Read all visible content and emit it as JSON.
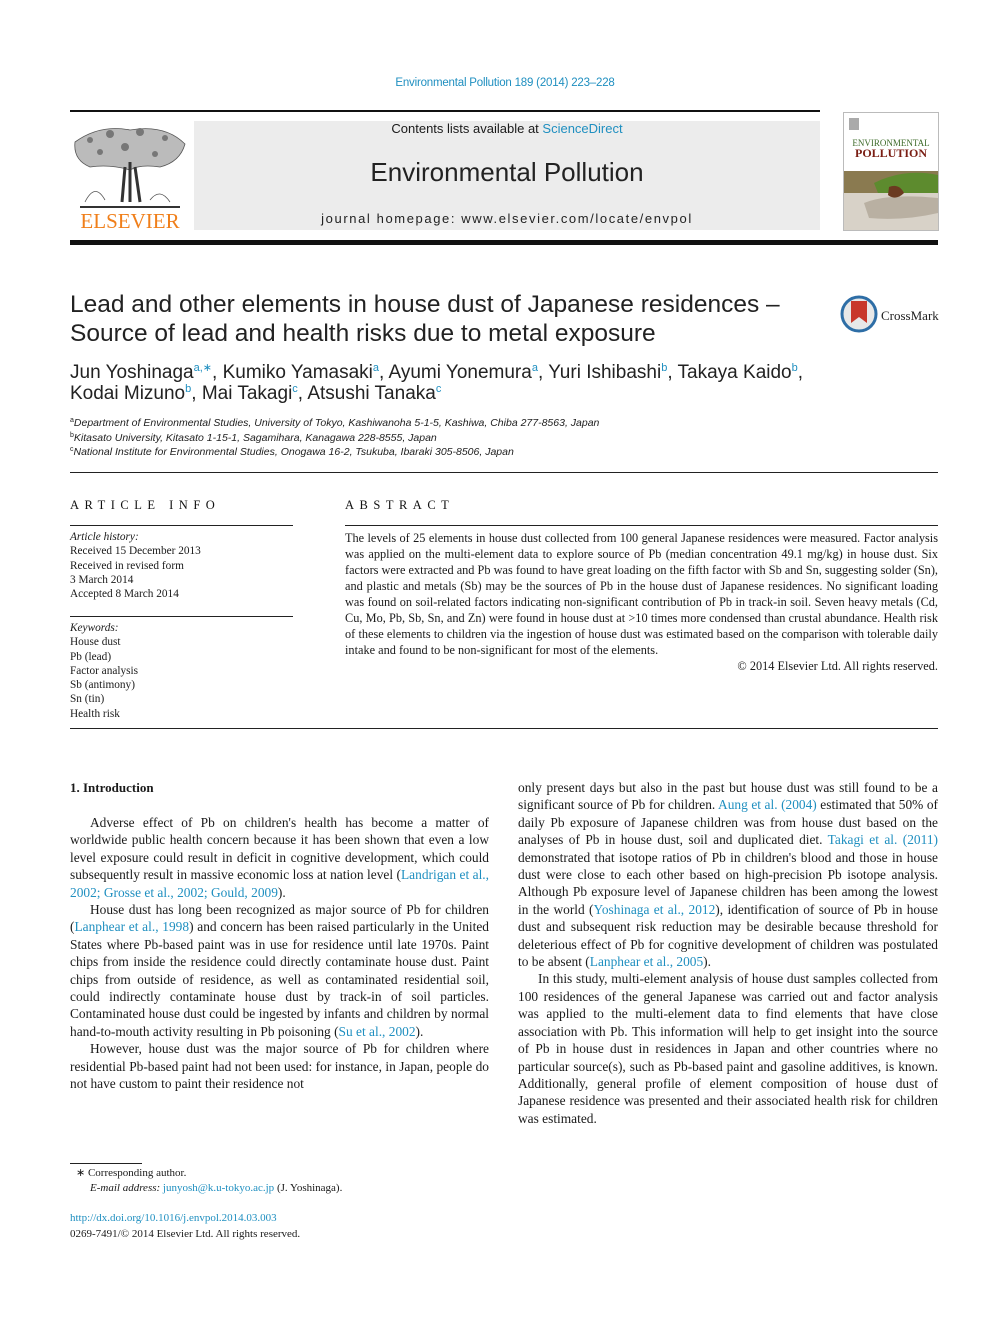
{
  "header": {
    "citation": "Environmental Pollution 189 (2014) 223–228",
    "contents_prefix": "Contents lists available at ",
    "contents_link": "ScienceDirect",
    "journal_name": "Environmental Pollution",
    "homepage": "journal homepage: www.elsevier.com/locate/envpol",
    "publisher_logo_text": "ELSEVIER",
    "cover_title_1": "ENVIRONMENTAL",
    "cover_title_2": "POLLUTION"
  },
  "article": {
    "title_line1": "Lead and other elements in house dust of Japanese residences –",
    "title_line2": "Source of lead and health risks due to metal exposure",
    "crossmark_label": "CrossMark",
    "authors": [
      {
        "name": "Jun Yoshinaga",
        "sup": "a,∗",
        "sep": ", "
      },
      {
        "name": "Kumiko Yamasaki",
        "sup": "a",
        "sep": ", "
      },
      {
        "name": "Ayumi Yonemura",
        "sup": "a",
        "sep": ", "
      },
      {
        "name": "Yuri Ishibashi",
        "sup": "b",
        "sep": ", "
      },
      {
        "name": "Takaya Kaido",
        "sup": "b",
        "sep": ","
      },
      {
        "name": "Kodai Mizuno",
        "sup": "b",
        "sep": ", "
      },
      {
        "name": "Mai Takagi",
        "sup": "c",
        "sep": ", "
      },
      {
        "name": "Atsushi Tanaka",
        "sup": "c",
        "sep": ""
      }
    ],
    "affiliations": [
      {
        "sup": "a",
        "text": "Department of Environmental Studies, University of Tokyo, Kashiwanoha 5-1-5, Kashiwa, Chiba 277-8563, Japan"
      },
      {
        "sup": "b",
        "text": "Kitasato University, Kitasato 1-15-1, Sagamihara, Kanagawa 228-8555, Japan"
      },
      {
        "sup": "c",
        "text": "National Institute for Environmental Studies, Onogawa 16-2, Tsukuba, Ibaraki 305-8506, Japan"
      }
    ]
  },
  "article_info": {
    "heading": "ARTICLE INFO",
    "history_label": "Article history:",
    "history": [
      "Received 15 December 2013",
      "Received in revised form",
      "3 March 2014",
      "Accepted 8 March 2014"
    ],
    "keywords_label": "Keywords:",
    "keywords": [
      "House dust",
      "Pb (lead)",
      "Factor analysis",
      "Sb (antimony)",
      "Sn (tin)",
      "Health risk"
    ]
  },
  "abstract": {
    "heading": "ABSTRACT",
    "text": "The levels of 25 elements in house dust collected from 100 general Japanese residences were measured. Factor analysis was applied on the multi-element data to explore source of Pb (median concentration 49.1 mg/kg) in house dust. Six factors were extracted and Pb was found to have great loading on the fifth factor with Sb and Sn, suggesting solder (Sn), and plastic and metals (Sb) may be the sources of Pb in the house dust of Japanese residences. No significant loading was found on soil-related factors indicating non-significant contribution of Pb in track-in soil. Seven heavy metals (Cd, Cu, Mo, Pb, Sb, Sn, and Zn) were found in house dust at >10 times more condensed than crustal abundance. Health risk of these elements to children via the ingestion of house dust was estimated based on the comparison with tolerable daily intake and found to be non-significant for most of the elements.",
    "copyright": "© 2014 Elsevier Ltd. All rights reserved."
  },
  "intro": {
    "heading": "1.  Introduction",
    "p1_a": "Adverse effect of Pb on children's health has become a matter of worldwide public health concern because it has been shown that even a low level exposure could result in deficit in cognitive development, which could subsequently result in massive economic loss at nation level (",
    "p1_ref": "Landrigan et al., 2002; Grosse et al., 2002; Gould, 2009",
    "p1_b": ").",
    "p2_a": "House dust has long been recognized as major source of Pb for children (",
    "p2_ref1": "Lanphear et al., 1998",
    "p2_b": ") and concern has been raised particularly in the United States where Pb-based paint was in use for residence until late 1970s. Paint chips from inside the residence could directly contaminate house dust. Paint chips from outside of residence, as well as contaminated residential soil, could indirectly contaminate house dust by track-in of soil particles. Contaminated house dust could be ingested by infants and children by normal hand-to-mouth activity resulting in Pb poisoning (",
    "p2_ref2": "Su et al., 2002",
    "p2_c": ").",
    "p3_a": "However, house dust was the major source of Pb for children where residential Pb-based paint had not been used: for instance, in Japan, people do not have custom to paint their residence not",
    "p3_b": "only present days but also in the past but house dust was still found to be a significant source of Pb for children. ",
    "p3_ref1": "Aung et al. (2004)",
    "p3_c": " estimated that 50% of daily Pb exposure of Japanese children was from house dust based on the analyses of Pb in house dust, soil and duplicated diet. ",
    "p3_ref2": "Takagi et al. (2011)",
    "p3_d": " demonstrated that isotope ratios of Pb in children's blood and those in house dust were close to each other based on high-precision Pb isotope analysis. Although Pb exposure level of Japanese children has been among the lowest in the world (",
    "p3_ref3": "Yoshinaga et al., 2012",
    "p3_e": "), identification of source of Pb in house dust and subsequent risk reduction may be desirable because threshold for deleterious effect of Pb for cognitive development of children was postulated to be absent (",
    "p3_ref4": "Lanphear et al., 2005",
    "p3_f": ").",
    "p4": "In this study, multi-element analysis of house dust samples collected from 100 residences of the general Japanese was carried out and factor analysis was applied to the multi-element data to find elements that have close association with Pb. This information will help to get insight into the source of Pb in house dust in residences in Japan and other countries where no particular source(s), such as Pb-based paint and gasoline additives, is known. Additionally, general profile of element composition of house dust of Japanese residence was presented and their associated health risk for children was estimated."
  },
  "footnotes": {
    "corresponding": "∗  Corresponding author.",
    "email_label": "E-mail address: ",
    "email": "junyosh@k.u-tokyo.ac.jp",
    "email_suffix": " (J. Yoshinaga).",
    "doi": "http://dx.doi.org/10.1016/j.envpol.2014.03.003",
    "issn": "0269-7491/© 2014 Elsevier Ltd. All rights reserved."
  },
  "colors": {
    "link": "#1f8fc0",
    "elsevier_orange": "#f07f1a",
    "banner_bg": "#ececec"
  }
}
